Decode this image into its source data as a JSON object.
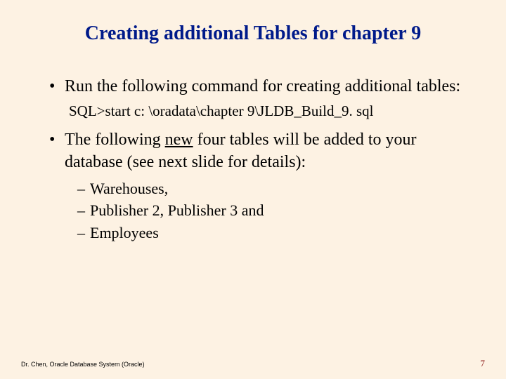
{
  "title": "Creating additional Tables for chapter 9",
  "bullets": [
    {
      "text": "Run the following command for creating additional tables:",
      "command": "SQL>start c: \\oradata\\chapter 9\\JLDB_Build_9. sql"
    },
    {
      "text_pre": "The following ",
      "text_underlined": "new",
      "text_post": " four tables will be added to your database (see next slide for details):",
      "subitems": [
        "Warehouses,",
        "Publisher 2, Publisher 3 and",
        "Employees"
      ]
    }
  ],
  "footer_left": "Dr. Chen, Oracle Database System (Oracle)",
  "footer_right": "7"
}
